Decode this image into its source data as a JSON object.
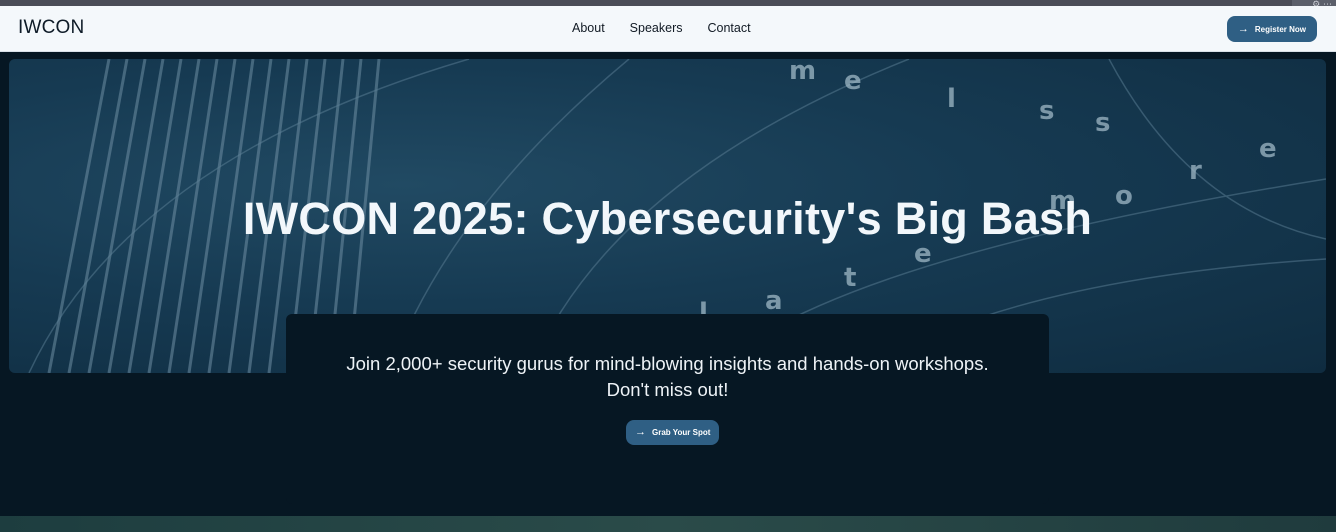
{
  "navbar": {
    "brand": "IWCON",
    "links": [
      "About",
      "Speakers",
      "Contact"
    ],
    "register_label": "Register Now"
  },
  "hero": {
    "title": "IWCON 2025: Cybersecurity's Big Bash",
    "subtitle_line1": "Join 2,000+ security gurus for mind-blowing insights and hands-on workshops.",
    "subtitle_line2": "Don't miss out!",
    "cta_label": "Grab Your Spot"
  },
  "icons": {
    "register_icon": "arrow-right-icon",
    "cta_icon": "arrow-right-icon"
  },
  "colors": {
    "navbar_bg": "#f4f8fb",
    "button_bg": "#2f5f84",
    "hero_panel_bg": "#061723",
    "hero_image_tint": "#163a52"
  }
}
